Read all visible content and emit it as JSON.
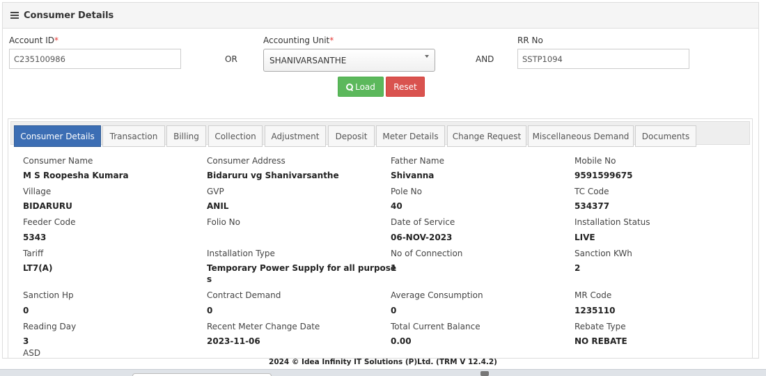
{
  "panel": {
    "title": "Consumer Details"
  },
  "form": {
    "account_id_label": "Account ID",
    "account_id_value": "C235100986",
    "or_text": "OR",
    "accounting_unit_label": "Accounting Unit",
    "accounting_unit_value": "SHANIVARSANTHE",
    "and_text": "AND",
    "rr_no_label": "RR No",
    "rr_no_value": "SSTP1094",
    "required_mark": "*",
    "load_label": "Load",
    "reset_label": "Reset"
  },
  "tabs": [
    {
      "label": "Consumer Details",
      "active": true
    },
    {
      "label": "Transaction"
    },
    {
      "label": "Billing"
    },
    {
      "label": "Collection"
    },
    {
      "label": "Adjustment"
    },
    {
      "label": "Deposit"
    },
    {
      "label": "Meter Details"
    },
    {
      "label": "Change Request"
    },
    {
      "label": "Miscellaneous Demand"
    },
    {
      "label": "Documents"
    }
  ],
  "details": [
    {
      "label": "Consumer Name",
      "value": "M S Roopesha Kumara"
    },
    {
      "label": "Consumer Address",
      "value": "Bidaruru vg Shanivarsanthe"
    },
    {
      "label": "Father Name",
      "value": "Shivanna"
    },
    {
      "label": "Mobile No",
      "value": "9591599675"
    },
    {
      "label": "Village",
      "value": "BIDARURU"
    },
    {
      "label": "GVP",
      "value": "ANIL"
    },
    {
      "label": "Pole No",
      "value": "40"
    },
    {
      "label": "TC Code",
      "value": "534377"
    },
    {
      "label": "Feeder Code",
      "value": "5343"
    },
    {
      "label": "Folio No",
      "value": ""
    },
    {
      "label": "Date of Service",
      "value": "06-NOV-2023"
    },
    {
      "label": "Installation Status",
      "value": "LIVE"
    },
    {
      "label": "Tariff",
      "value": "LT7(A)"
    },
    {
      "label": "Installation Type",
      "value": "Temporary Power Supply for all purpose",
      "value_wrap": "s"
    },
    {
      "label": "No of Connection",
      "value": "1"
    },
    {
      "label": "Sanction KWh",
      "value": "2"
    },
    {
      "label": "Sanction Hp",
      "value": "0"
    },
    {
      "label": "Contract Demand",
      "value": "0"
    },
    {
      "label": "Average Consumption",
      "value": "0"
    },
    {
      "label": "MR Code",
      "value": "1235110"
    },
    {
      "label": "Reading Day",
      "value": "3"
    },
    {
      "label": "Recent Meter Change Date",
      "value": "2023-11-06"
    },
    {
      "label": "Total Current Balance",
      "value": "0.00"
    },
    {
      "label": "Rebate Type",
      "value": "NO REBATE"
    },
    {
      "label": "ASD",
      "value": ""
    }
  ],
  "footer": {
    "text": "2024 © Idea Infinity IT Solutions (P)Ltd. (TRM V 12.4.2)"
  },
  "colors": {
    "active_tab": "#3c6eb4",
    "load_button": "#5cb85c",
    "reset_button": "#d9534f",
    "required": "#e53935"
  },
  "icons": {
    "menu": "hamburger-icon",
    "load": "search-icon",
    "select": "chevron-down-icon"
  }
}
